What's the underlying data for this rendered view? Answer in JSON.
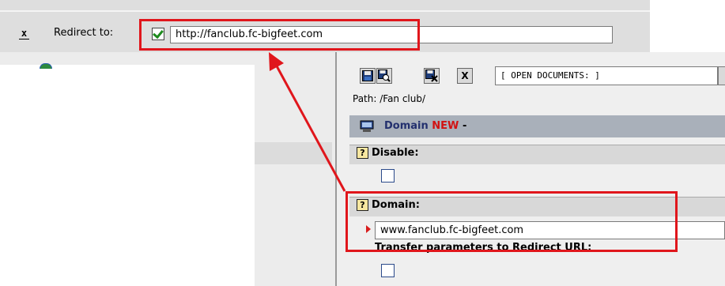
{
  "top_bar": {
    "close_label": "x",
    "redirect_label": "Redirect to:",
    "redirect_checked": true,
    "redirect_url": "http://fanclub.fc-bigfeet.com"
  },
  "toolbar": {
    "buttons": [
      "save-icon",
      "save-view-icon",
      "save-close-icon",
      "close-icon"
    ],
    "close_label": "X",
    "open_documents": "[ OPEN DOCUMENTS: ]"
  },
  "path": "Path: /Fan club/",
  "record": {
    "title": "Domain",
    "status": "NEW",
    "suffix": "-"
  },
  "fields": {
    "disable": {
      "label": "Disable:",
      "checked": false,
      "help": "?"
    },
    "domain": {
      "label": "Domain:",
      "value": "www.fanclub.fc-bigfeet.com",
      "help": "?"
    },
    "transfer": {
      "label": "Transfer parameters to Redirect URL:",
      "checked": false
    }
  },
  "annotation": {
    "color": "#e0161c"
  }
}
